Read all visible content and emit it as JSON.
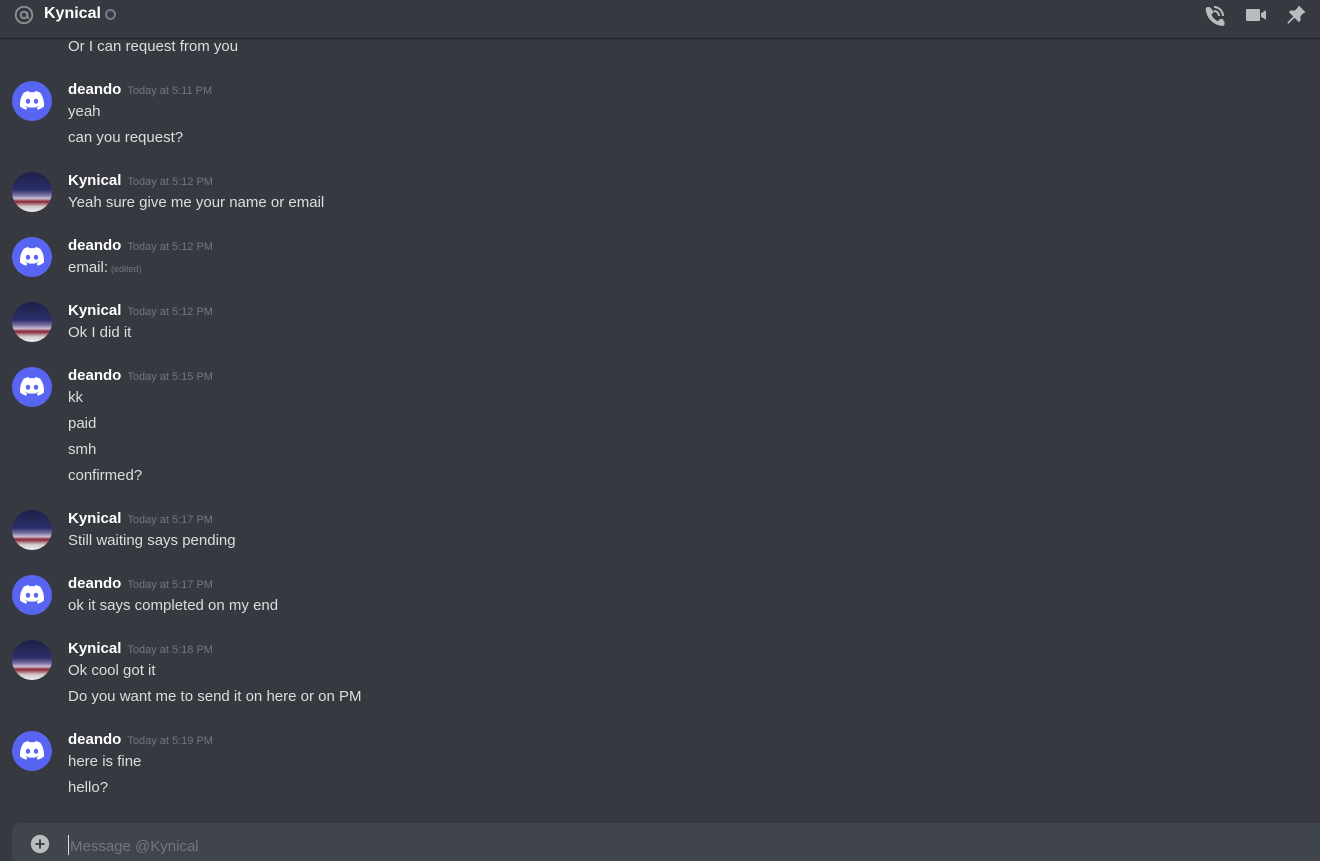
{
  "header": {
    "title": "Kynical",
    "icons": [
      "at-icon",
      "status-offline-icon",
      "phone-call-icon",
      "video-camera-icon",
      "pin-icon"
    ]
  },
  "messages": {
    "top_fragment": "Or I can request from you",
    "groups": [
      {
        "author": "deando",
        "timestamp": "Today at 5:11 PM",
        "avatar": "discord-default-avatar",
        "lines": [
          "yeah",
          "can you request?"
        ]
      },
      {
        "author": "Kynical",
        "timestamp": "Today at 5:12 PM",
        "avatar": "profile-photo-avatar",
        "lines": [
          "Yeah sure give me your name or email"
        ]
      },
      {
        "author": "deando",
        "timestamp": "Today at 5:12 PM",
        "avatar": "discord-default-avatar",
        "lines": [
          "email:"
        ],
        "edited": "(edited)"
      },
      {
        "author": "Kynical",
        "timestamp": "Today at 5:12 PM",
        "avatar": "profile-photo-avatar",
        "lines": [
          "Ok I did it"
        ]
      },
      {
        "author": "deando",
        "timestamp": "Today at 5:15 PM",
        "avatar": "discord-default-avatar",
        "lines": [
          "kk",
          "paid",
          "smh",
          "confirmed?"
        ]
      },
      {
        "author": "Kynical",
        "timestamp": "Today at 5:17 PM",
        "avatar": "profile-photo-avatar",
        "lines": [
          "Still waiting says pending"
        ]
      },
      {
        "author": "deando",
        "timestamp": "Today at 5:17 PM",
        "avatar": "discord-default-avatar",
        "lines": [
          "ok it says completed on my end"
        ]
      },
      {
        "author": "Kynical",
        "timestamp": "Today at 5:18 PM",
        "avatar": "profile-photo-avatar",
        "lines": [
          "Ok cool got it",
          "Do you want me to send it on here or on PM"
        ]
      },
      {
        "author": "deando",
        "timestamp": "Today at 5:19 PM",
        "avatar": "discord-default-avatar",
        "lines": [
          "here is fine",
          "hello?"
        ]
      }
    ]
  },
  "composer": {
    "placeholder": "Message @Kynical",
    "value": "",
    "icons": [
      "add-attachment-icon"
    ]
  },
  "colors": {
    "background": "#36393f",
    "composer": "#40444b",
    "blurple": "#5865f2",
    "text": "#dcddde",
    "muted": "#72767d",
    "header_icon": "#b9bbbe"
  }
}
